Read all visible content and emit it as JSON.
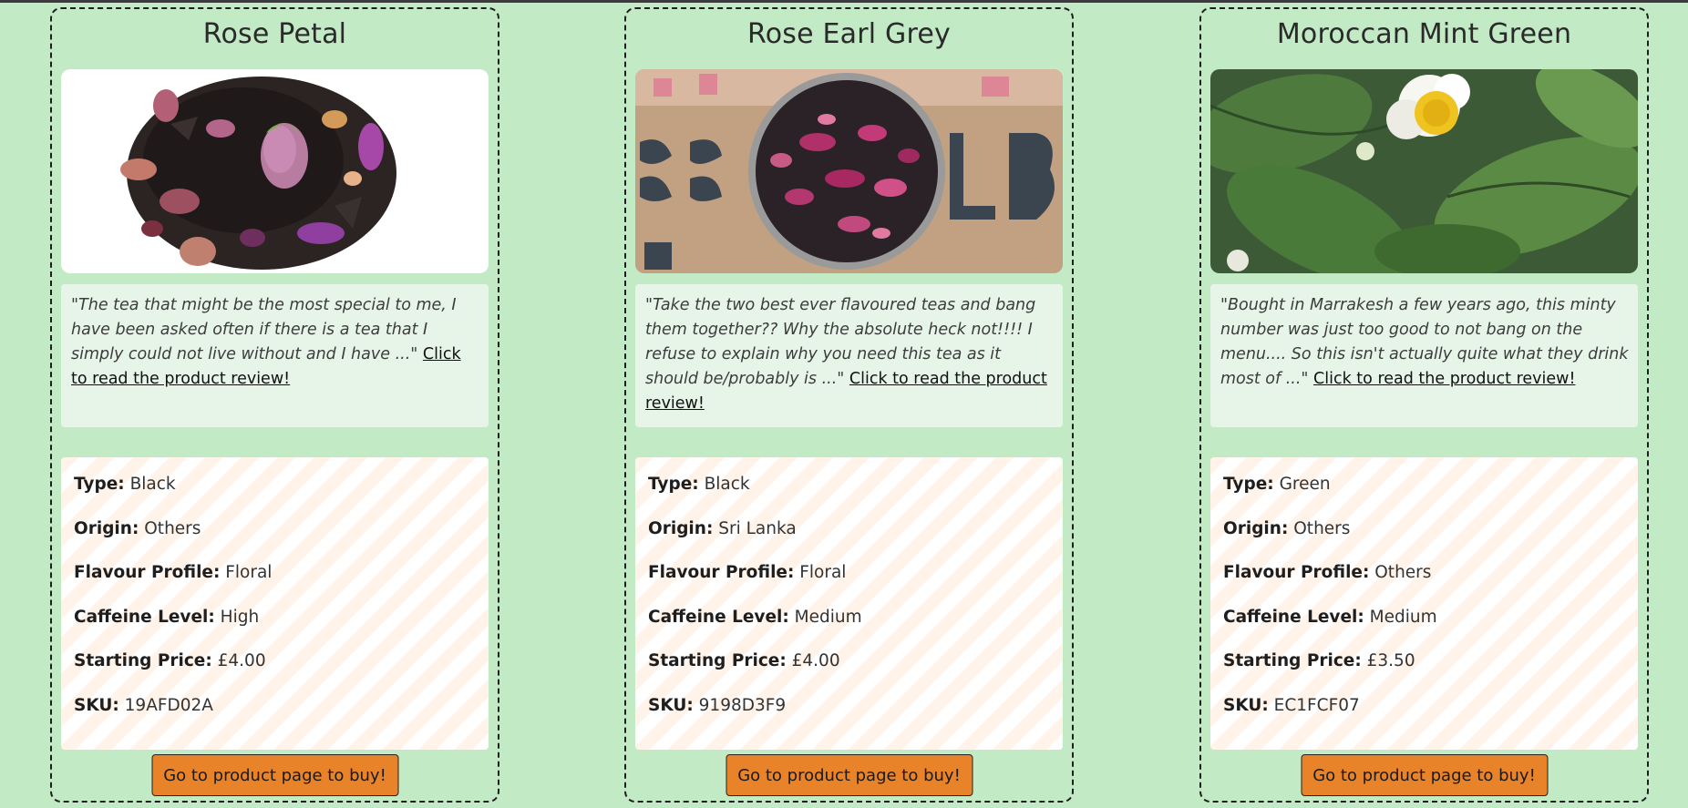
{
  "colors": {
    "page_background": "#c2eac4",
    "review_background": "#e6f5e8",
    "button_background": "#e8832a",
    "details_stripe": "#fff3ea"
  },
  "labels": {
    "type": "Type:",
    "origin": "Origin:",
    "flavour": "Flavour Profile:",
    "caffeine": "Caffeine Level:",
    "price": "Starting Price:",
    "sku": "SKU:"
  },
  "products": [
    {
      "name": "Rose Petal",
      "image": "loose black tea with dried rose buds and petals",
      "review_quote": "\"The tea that might be the most special to me, I have been asked often if there is a tea that I simply could not live without and I have ...\"",
      "review_link": "Click to read the product review!",
      "type": "Black",
      "origin": "Others",
      "flavour": "Floral",
      "caffeine": "High",
      "price": "£4.00",
      "sku": "19AFD02A",
      "button": "Go to product page to buy!"
    },
    {
      "name": "Rose Earl Grey",
      "image": "tin of rose earl grey tea on a stencilled wooden crate",
      "review_quote": "\"Take the two best ever flavoured teas and bang them together?? Why the absolute heck not!!!! I refuse to explain why you need this tea as it should be/probably is ...\"",
      "review_link": "Click to read the product review!",
      "type": "Black",
      "origin": "Sri Lanka",
      "flavour": "Floral",
      "caffeine": "Medium",
      "price": "£4.00",
      "sku": "9198D3F9",
      "button": "Go to product page to buy!"
    },
    {
      "name": "Moroccan Mint Green",
      "image": "tea plant leaves with a white flower",
      "review_quote": "\"Bought in Marrakesh a few years ago, this minty number was just too good to not bang on the menu.... So this isn't actually quite what they drink most of ...\"",
      "review_link": "Click to read the product review!",
      "type": "Green",
      "origin": "Others",
      "flavour": "Others",
      "caffeine": "Medium",
      "price": "£3.50",
      "sku": "EC1FCF07",
      "button": "Go to product page to buy!"
    }
  ]
}
